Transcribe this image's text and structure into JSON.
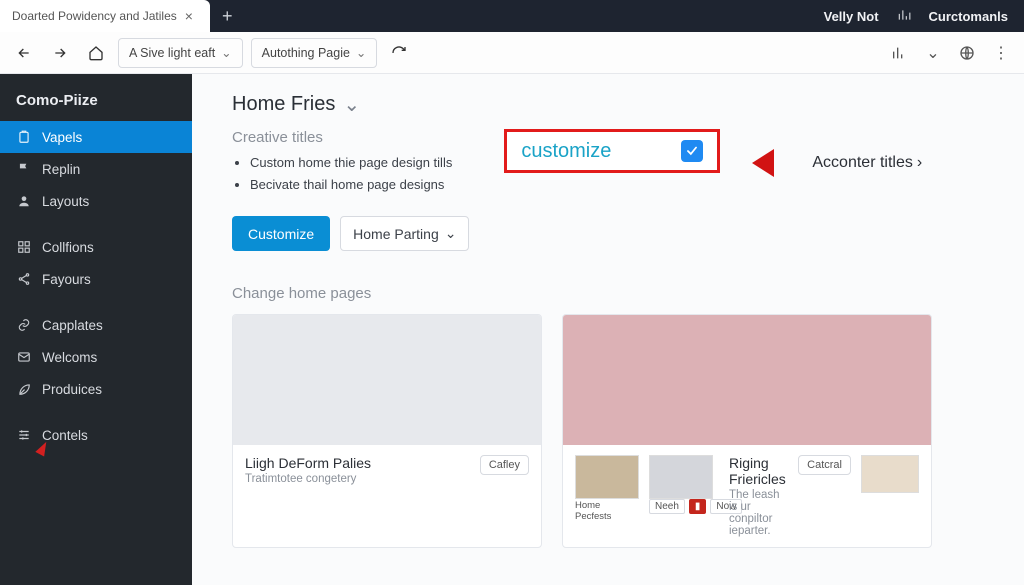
{
  "browser": {
    "tab_title": "Doarted Powidency and Jatiles",
    "toolbar": {
      "chip1": "A Sive light eaft",
      "chip2": "Autothing Pagie"
    },
    "top_right": {
      "label1": "Velly Not",
      "label2": "Curctomanls"
    }
  },
  "sidebar": {
    "title": "Como-Piize",
    "items": [
      {
        "icon": "clipboard-icon",
        "label": "Vapels",
        "active": true
      },
      {
        "icon": "flag-icon",
        "label": "Replin"
      },
      {
        "icon": "person-icon",
        "label": "Layouts"
      },
      {
        "icon": "grid-icon",
        "label": "Collfions"
      },
      {
        "icon": "share-icon",
        "label": "Fayours"
      },
      {
        "icon": "link-icon",
        "label": "Capplates"
      },
      {
        "icon": "mail-icon",
        "label": "Welcoms"
      },
      {
        "icon": "leaf-icon",
        "label": "Produices"
      },
      {
        "icon": "sliders-icon",
        "label": "Contels"
      }
    ]
  },
  "main": {
    "page_title": "Home Fries",
    "creative": {
      "heading": "Creative titles",
      "bullets": [
        "Custom home thie page design tills",
        "Becivate thail home page designs"
      ]
    },
    "customize_label": "customize",
    "acconter_label": "Acconter titles",
    "buttons": {
      "customize": "Customize",
      "home_parting": "Home Parting"
    },
    "section_label": "Change home pages",
    "cards": {
      "a": {
        "title": "Liigh DeForm Palies",
        "sub": "Tratimtotee congetery",
        "chip": "Cafley"
      },
      "b": {
        "title": "Riging Friericles",
        "sub": "The leash is ur conpiltor ieparter.",
        "chip": "Catcral",
        "mini1_cap": "Home Pecfests",
        "tag1": "Neeh",
        "tag2": "Now"
      }
    }
  }
}
